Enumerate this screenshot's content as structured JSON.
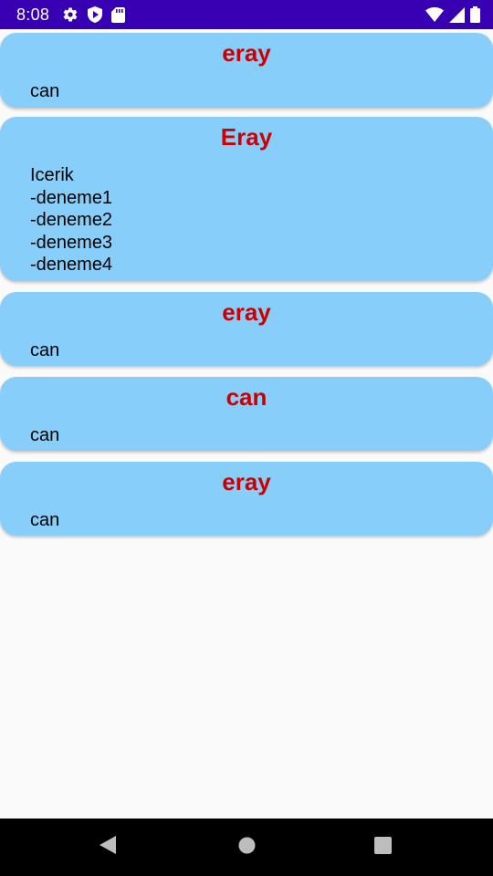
{
  "status_bar": {
    "time": "8:08",
    "left_icons": [
      "settings-icon",
      "shield-icon",
      "sd-card-icon"
    ],
    "right_icons": [
      "wifi-icon",
      "signal-icon",
      "battery-icon"
    ],
    "background": "#3700b3"
  },
  "cards": [
    {
      "title": "eray",
      "body": "can"
    },
    {
      "title": "Eray",
      "body": "Icerik\n-deneme1\n-deneme2\n-deneme3\n-deneme4"
    },
    {
      "title": "eray",
      "body": "can"
    },
    {
      "title": "can",
      "body": "can"
    },
    {
      "title": "eray",
      "body": "can"
    }
  ],
  "colors": {
    "card_background": "#87cefa",
    "card_title": "#cc0000",
    "page_background": "#fafafa"
  },
  "nav_bar": {
    "buttons": [
      "back-icon",
      "home-icon",
      "recents-icon"
    ]
  }
}
